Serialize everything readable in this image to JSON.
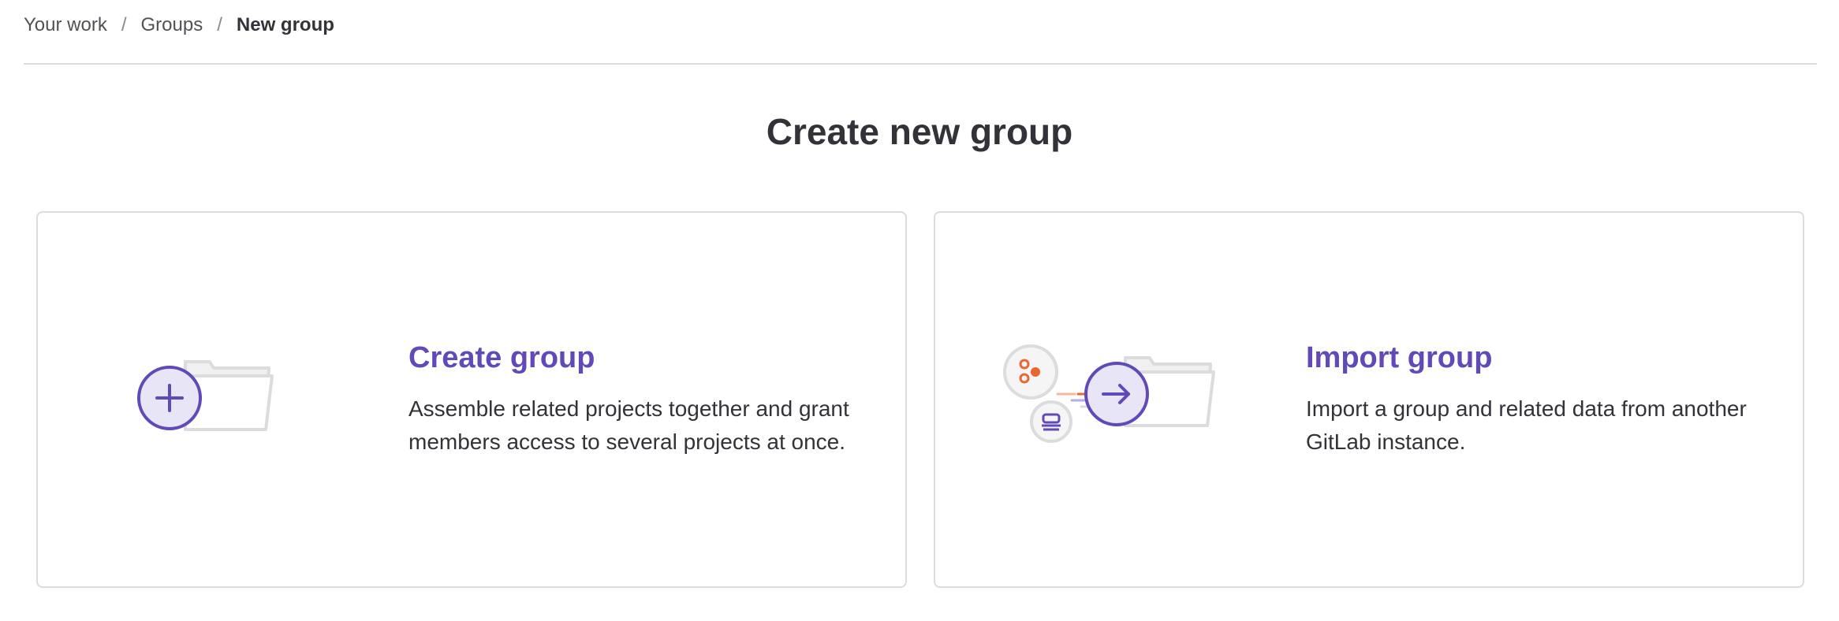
{
  "breadcrumb": {
    "items": [
      "Your work",
      "Groups"
    ],
    "current": "New group",
    "separator": "/"
  },
  "page": {
    "title": "Create new group"
  },
  "cards": {
    "create": {
      "title": "Create group",
      "description": "Assemble related projects together and grant members access to several projects at once.",
      "icon": "folder-plus-illustration"
    },
    "import": {
      "title": "Import group",
      "description": "Import a group and related data from another GitLab instance.",
      "icon": "folder-import-illustration"
    }
  },
  "colors": {
    "accent": "#6149b8",
    "accent_light": "#e8e5f7",
    "orange": "#e9682f",
    "border": "#dcdcde"
  }
}
